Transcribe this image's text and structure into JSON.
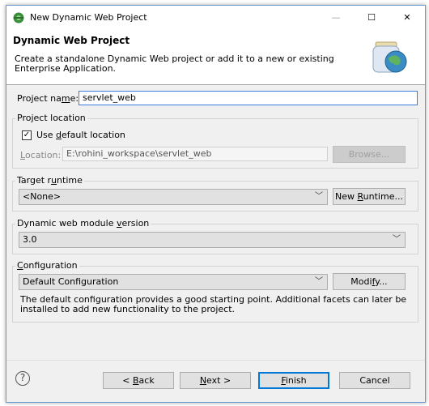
{
  "window": {
    "title": "New Dynamic Web Project",
    "minimize_glyph": "—",
    "maximize_glyph": "☐",
    "close_glyph": "✕"
  },
  "header": {
    "title": "Dynamic Web Project",
    "description": "Create a standalone Dynamic Web project or add it to a new or existing Enterprise Application."
  },
  "project_name": {
    "label_pre": "Project na",
    "label_accel": "m",
    "label_post": "e:",
    "value": "servlet_web"
  },
  "project_location": {
    "title": "Project location",
    "use_default_pre": "Use ",
    "use_default_accel": "d",
    "use_default_post": "efault location",
    "use_default_checked": true,
    "check_glyph": "✓",
    "location_label_accel": "L",
    "location_label_post": "ocation:",
    "location_value": "E:\\rohini_workspace\\servlet_web",
    "browse_label": "Browse..."
  },
  "target_runtime": {
    "title_pre": "Target r",
    "title_accel": "u",
    "title_post": "ntime",
    "selected": "<None>",
    "new_runtime_pre": "New ",
    "new_runtime_accel": "R",
    "new_runtime_post": "untime..."
  },
  "module_version": {
    "title_pre": "Dynamic web module ",
    "title_accel": "v",
    "title_post": "ersion",
    "selected": "3.0"
  },
  "configuration": {
    "title_accel": "C",
    "title_post": "onfiguration",
    "selected": "Default Configuration",
    "modify_pre": "Modi",
    "modify_accel": "f",
    "modify_post": "y...",
    "description": "The default configuration provides a good starting point. Additional facets can later be installed to add new functionality to the project."
  },
  "footer": {
    "help_glyph": "?",
    "back_pre": "< ",
    "back_accel": "B",
    "back_post": "ack",
    "next_accel": "N",
    "next_post": "ext >",
    "finish_accel": "F",
    "finish_post": "inish",
    "cancel_label": "Cancel"
  },
  "colors": {
    "accent": "#0078d7",
    "window_bg": "#f0f0f0",
    "border": "#6a9ad4"
  },
  "icons": [
    "eclipse-app-icon",
    "web-project-jar-icon",
    "checkbox-check-icon",
    "chevron-down-icon",
    "help-icon"
  ]
}
